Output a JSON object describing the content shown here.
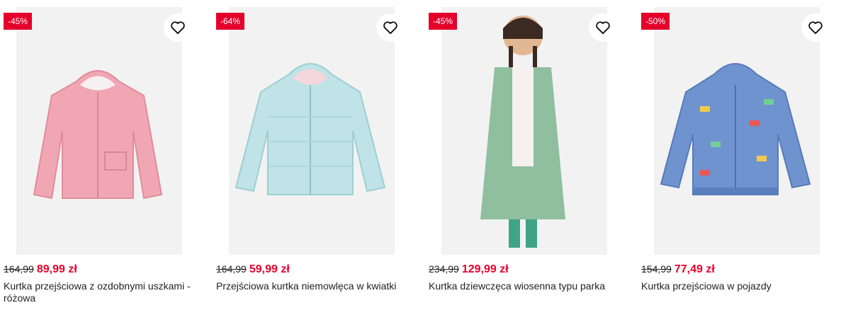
{
  "products": [
    {
      "discount": "-45%",
      "old_price": "164,99",
      "new_price": "89,99 zł",
      "name": "Kurtka przejściowa z ozdobnymi uszkami - różowa",
      "jacket_color": "#f1a7b3"
    },
    {
      "discount": "-64%",
      "old_price": "164,99",
      "new_price": "59,99 zł",
      "name": "Przejściowa kurtka niemowlęca w kwiatki",
      "jacket_color": "#bfe3e6"
    },
    {
      "discount": "-45%",
      "old_price": "234,99",
      "new_price": "129,99 zł",
      "name": "Kurtka dziewczęca wiosenna typu parka",
      "jacket_color": "#8fbf9f"
    },
    {
      "discount": "-50%",
      "old_price": "154,99",
      "new_price": "77,49 zł",
      "name": "Kurtka przejściowa w pojazdy",
      "jacket_color": "#6f93cf"
    }
  ],
  "colors": {
    "accent": "#e4002b",
    "image_bg": "#f2f2f2"
  },
  "icons": {
    "favorite": "heart-outline-icon"
  }
}
